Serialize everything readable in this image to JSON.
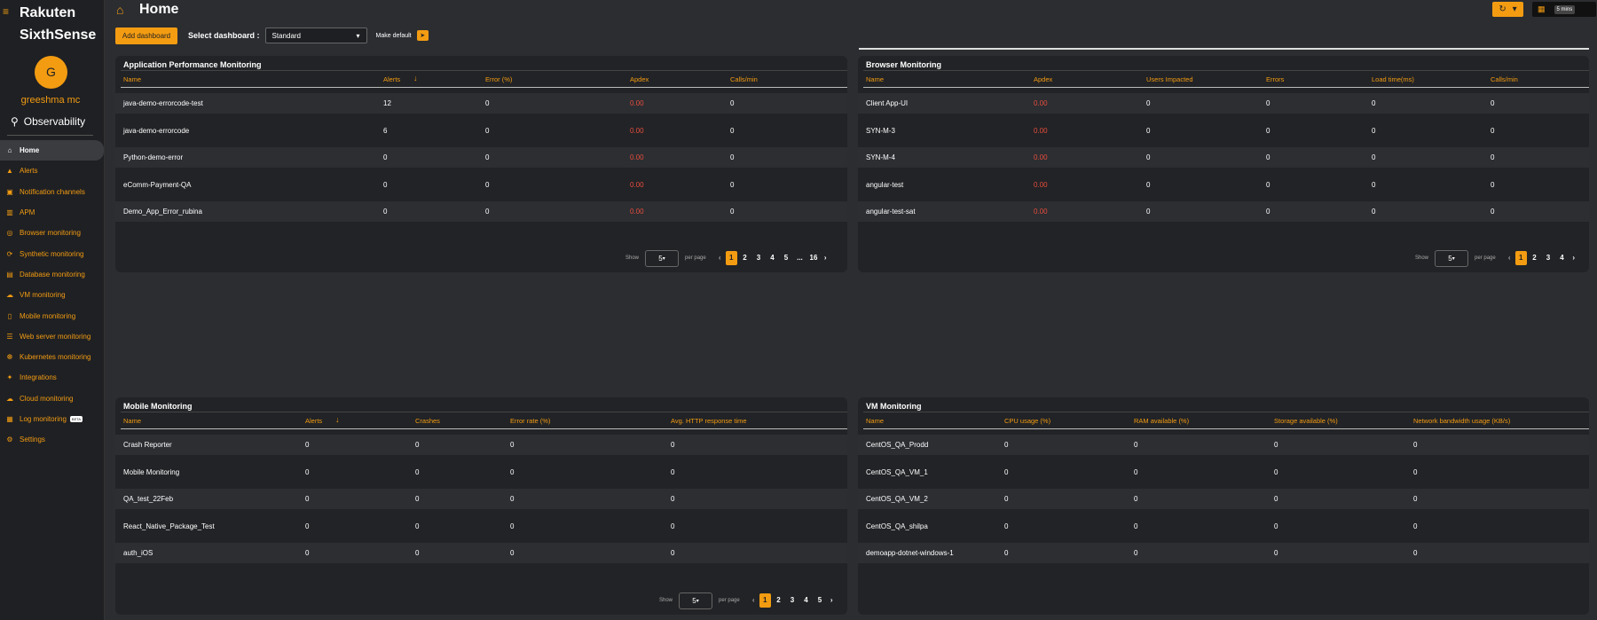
{
  "brand": {
    "line1": "Rakuten",
    "line2": "SixthSense"
  },
  "user": {
    "initial": "G",
    "name": "greeshma mc"
  },
  "section": "Observability",
  "nav": [
    {
      "label": "Home",
      "icon": "home-icon",
      "active": true
    },
    {
      "label": "Alerts",
      "icon": "bell-icon"
    },
    {
      "label": "Notification channels",
      "icon": "notification-channels-icon"
    },
    {
      "label": "APM",
      "icon": "apm-icon"
    },
    {
      "label": "Browser monitoring",
      "icon": "globe-icon"
    },
    {
      "label": "Synthetic monitoring",
      "icon": "synthetic-icon"
    },
    {
      "label": "Database monitoring",
      "icon": "database-icon"
    },
    {
      "label": "VM monitoring",
      "icon": "vm-icon"
    },
    {
      "label": "Mobile monitoring",
      "icon": "mobile-icon"
    },
    {
      "label": "Web server monitoring",
      "icon": "server-icon"
    },
    {
      "label": "Kubernetes monitoring",
      "icon": "kubernetes-icon"
    },
    {
      "label": "Integrations",
      "icon": "integrations-icon"
    },
    {
      "label": "Cloud monitoring",
      "icon": "cloud-icon"
    },
    {
      "label": "Log monitoring",
      "icon": "log-icon",
      "badge": "BETA"
    },
    {
      "label": "Settings",
      "icon": "gear-icon"
    }
  ],
  "header": {
    "title": "Home",
    "interval": "5 mins"
  },
  "toolbar": {
    "add_dashboard": "Add dashboard",
    "select_label": "Select dashboard :",
    "selected": "Standard",
    "make_default": "Make default"
  },
  "pager_labels": {
    "show": "Show",
    "per_page": "per page",
    "per_page_value": "5"
  },
  "apm": {
    "title": "Application Performance Monitoring",
    "columns": [
      "Name",
      "Alerts",
      "Error (%)",
      "Apdex",
      "Calls/min"
    ],
    "rows": [
      [
        "java-demo-errorcode-test",
        "12",
        "0",
        "0.00",
        "0"
      ],
      [
        "java-demo-errorcode",
        "6",
        "0",
        "0.00",
        "0"
      ],
      [
        "Python-demo-error",
        "0",
        "0",
        "0.00",
        "0"
      ],
      [
        "eComm-Payment-QA",
        "0",
        "0",
        "0.00",
        "0"
      ],
      [
        "Demo_App_Error_rubina",
        "0",
        "0",
        "0.00",
        "0"
      ]
    ],
    "pages": [
      "1",
      "2",
      "3",
      "4",
      "5",
      "...",
      "16"
    ]
  },
  "browser": {
    "title": "Browser Monitoring",
    "columns": [
      "Name",
      "Apdex",
      "Users Impacted",
      "Errors",
      "Load time(ms)",
      "Calls/min"
    ],
    "rows": [
      [
        "Client App-UI",
        "0.00",
        "0",
        "0",
        "0",
        "0"
      ],
      [
        "SYN-M-3",
        "0.00",
        "0",
        "0",
        "0",
        "0"
      ],
      [
        "SYN-M-4",
        "0.00",
        "0",
        "0",
        "0",
        "0"
      ],
      [
        "angular-test",
        "0.00",
        "0",
        "0",
        "0",
        "0"
      ],
      [
        "angular-test-sat",
        "0.00",
        "0",
        "0",
        "0",
        "0"
      ]
    ],
    "pages": [
      "1",
      "2",
      "3",
      "4"
    ]
  },
  "mobile": {
    "title": "Mobile Monitoring",
    "columns": [
      "Name",
      "Alerts",
      "Crashes",
      "Error rate (%)",
      "Avg. HTTP response time"
    ],
    "rows": [
      [
        "Crash Reporter",
        "0",
        "0",
        "0",
        "0"
      ],
      [
        "Mobile Monitoring",
        "0",
        "0",
        "0",
        "0"
      ],
      [
        "QA_test_22Feb",
        "0",
        "0",
        "0",
        "0"
      ],
      [
        "React_Native_Package_Test",
        "0",
        "0",
        "0",
        "0"
      ],
      [
        "auth_iOS",
        "0",
        "0",
        "0",
        "0"
      ]
    ],
    "pages": [
      "1",
      "2",
      "3",
      "4",
      "5"
    ]
  },
  "vm": {
    "title": "VM Monitoring",
    "columns": [
      "Name",
      "CPU usage (%)",
      "RAM available (%)",
      "Storage available (%)",
      "Network bandwidth usage (KB/s)"
    ],
    "rows": [
      [
        "CentOS_QA_Prodd",
        "0",
        "0",
        "0",
        "0"
      ],
      [
        "CentOS_QA_VM_1",
        "0",
        "0",
        "0",
        "0"
      ],
      [
        "CentOS_QA_VM_2",
        "0",
        "0",
        "0",
        "0"
      ],
      [
        "CentOS_QA_shilpa",
        "0",
        "0",
        "0",
        "0"
      ],
      [
        "demoapp-dotnet-windows-1",
        "0",
        "0",
        "0",
        "0"
      ]
    ]
  },
  "colors": {
    "accent": "#f39c12",
    "danger": "#e74c3c",
    "panel": "#222326",
    "background": "#2b2d31"
  }
}
